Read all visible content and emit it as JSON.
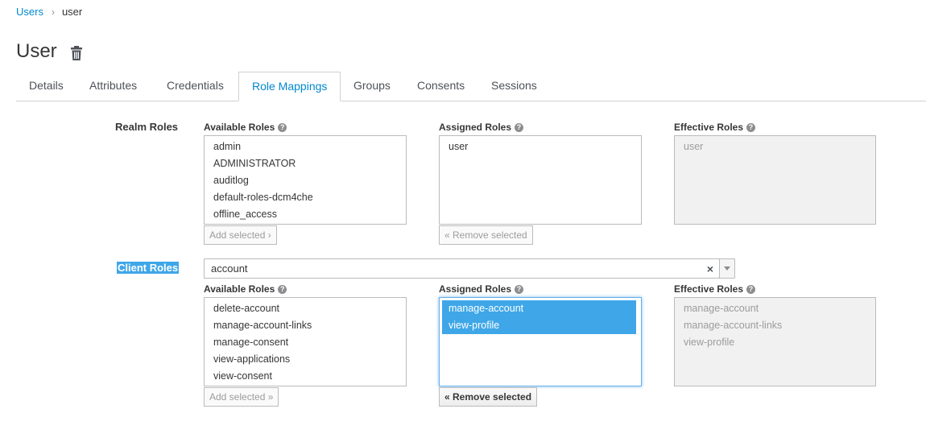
{
  "breadcrumb": {
    "parent": "Users",
    "current": "user"
  },
  "page": {
    "title": "User"
  },
  "tabs": [
    {
      "label": "Details"
    },
    {
      "label": "Attributes"
    },
    {
      "label": "Credentials"
    },
    {
      "label": "Role Mappings",
      "active": true
    },
    {
      "label": "Groups"
    },
    {
      "label": "Consents"
    },
    {
      "label": "Sessions"
    }
  ],
  "realm": {
    "label": "Realm Roles",
    "available_label": "Available Roles",
    "assigned_label": "Assigned Roles",
    "effective_label": "Effective Roles",
    "available": [
      "admin",
      "ADMINISTRATOR",
      "auditlog",
      "default-roles-dcm4che",
      "offline_access"
    ],
    "assigned": [
      "user"
    ],
    "effective": [
      "user"
    ],
    "add_button": "Add selected ›",
    "remove_button": "« Remove selected"
  },
  "client": {
    "label": "Client Roles",
    "selected_client": "account",
    "clear_glyph": "×",
    "available_label": "Available Roles",
    "assigned_label": "Assigned Roles",
    "effective_label": "Effective Roles",
    "available": [
      "delete-account",
      "manage-account-links",
      "manage-consent",
      "view-applications",
      "view-consent"
    ],
    "assigned": [
      "manage-account",
      "view-profile"
    ],
    "assigned_selected": [
      "manage-account",
      "view-profile"
    ],
    "effective": [
      "manage-account",
      "manage-account-links",
      "view-profile"
    ],
    "add_button": "Add selected »",
    "remove_button": "« Remove selected"
  },
  "colors": {
    "accent": "#0088ce",
    "selection": "#3fa7e8",
    "disabled_bg": "#f1f1f1"
  },
  "help_glyph": "?"
}
